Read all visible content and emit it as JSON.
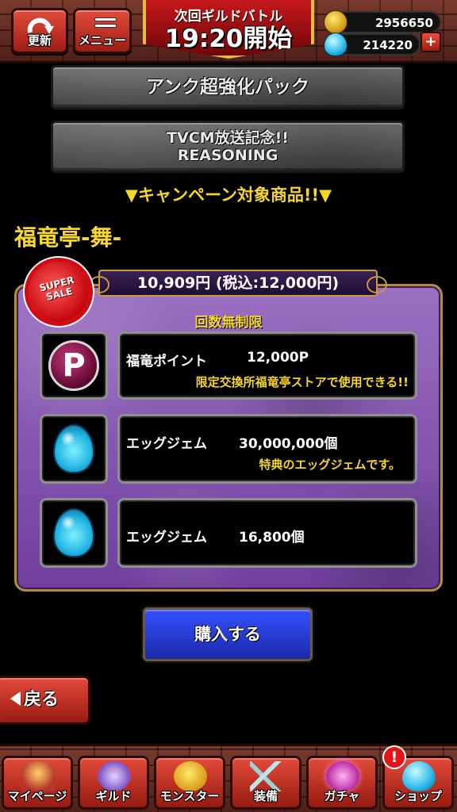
{
  "topbar": {
    "refresh_label": "更新",
    "menu_label": "メニュー",
    "battle_subtitle": "次回ギルドバトル",
    "battle_time": "19:20開始",
    "coins": "2956650",
    "gems": "214220",
    "add_label": "+"
  },
  "packs": {
    "pack1": "アンク超強化パック",
    "pack2_line1": "TVCM放送記念!!",
    "pack2_line2": "REASONING"
  },
  "campaign_label": "▼キャンペーン対象商品!!▼",
  "product": {
    "name": "福竜亭-舞-",
    "price": "10,909円 (税込:12,000円)",
    "sale_badge_line1": "SUPER",
    "sale_badge_line2": "SALE",
    "limit_label": "回数無制限",
    "items": [
      {
        "icon": "p-point-icon",
        "name": "福竜ポイント",
        "amount": "12,000P",
        "note": "限定交換所福竜亭ストアで使用できる!!"
      },
      {
        "icon": "egg-gem-icon",
        "name": "エッグジェム",
        "amount": "30,000,000個",
        "note": "特典のエッグジェムです。"
      },
      {
        "icon": "egg-gem-icon",
        "name": "エッグジェム",
        "amount": "16,800個",
        "note": ""
      }
    ]
  },
  "buy_label": "購入する",
  "back_label": "戻る",
  "nav": {
    "mypage": "マイページ",
    "guild": "ギルド",
    "monster": "モンスター",
    "equip": "装備",
    "gacha": "ガチャ",
    "shop": "ショップ",
    "notification": "!"
  },
  "colors": {
    "accent_yellow": "#f6d52c",
    "panel_purple": "#8a5bb5",
    "buy_blue": "#2a3fe0",
    "button_red": "#c7342a"
  }
}
